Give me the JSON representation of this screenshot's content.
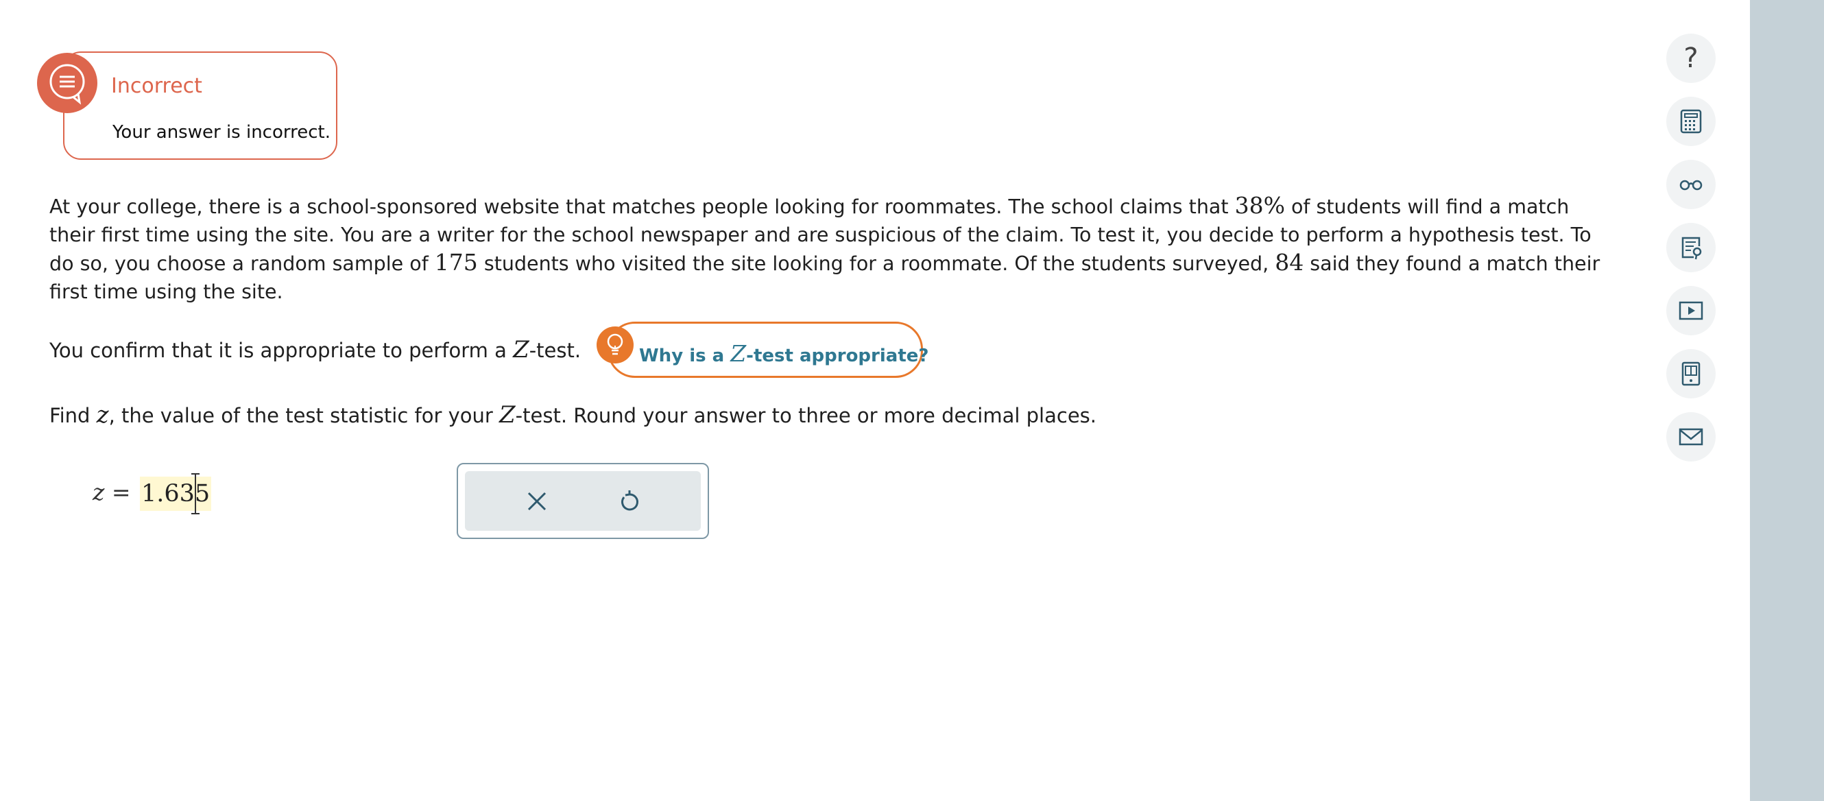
{
  "feedback": {
    "title": "Incorrect",
    "message": "Your answer is incorrect."
  },
  "problem": {
    "p1": "At your college, there is a school-sponsored website that matches people looking for roommates. The school claims that ",
    "pct": "38%",
    "p2": " of students will find a match their first time using the site. You are a writer for the school newspaper and are suspicious of the claim. To test it, you decide to perform a hypothesis test. To do so, you choose a random sample of ",
    "n": "175",
    "p3": " students who visited the site looking for a roommate. Of the students surveyed, ",
    "x": "84",
    "p4": " said they found a match their first time using the site."
  },
  "confirm": {
    "pre": "You confirm that it is appropriate to perform a ",
    "z": "Z",
    "post": "-test."
  },
  "hint": {
    "pre": "Why is a ",
    "z": "Z",
    "post": "-test appropriate?"
  },
  "question": {
    "pre": "Find ",
    "zvar": "z",
    "mid": ", the value of the test statistic for your ",
    "Z": "Z",
    "post": "-test. Round your answer to three or more decimal places."
  },
  "answer": {
    "label_var": "z",
    "label_eq": "=",
    "value": "1.635"
  },
  "toolbar": {
    "help": "?"
  },
  "colors": {
    "incorrect": "#dd664d",
    "hint_orange": "#e8782b",
    "hint_text": "#2f7891",
    "rail": "#c5d1d7"
  }
}
